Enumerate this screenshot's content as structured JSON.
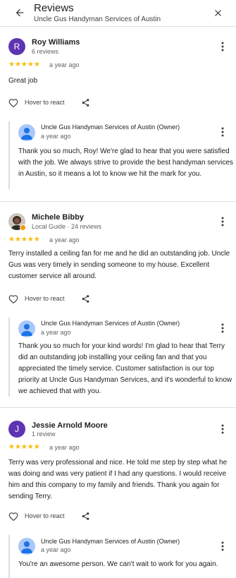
{
  "header": {
    "title": "Reviews",
    "subtitle": "Uncle Gus Handyman Services of Austin",
    "back_icon": "arrow-back-icon",
    "close_icon": "close-icon"
  },
  "colors": {
    "star": "#fbbc04",
    "avatar_roy": "#5e35b1",
    "avatar_jessie": "#5e35b1",
    "owner_avatar": "#a8c7fa",
    "guide_badge": "#f29900"
  },
  "reviews": [
    {
      "avatar_letter": "R",
      "name": "Roy Williams",
      "meta": "6 reviews",
      "rating": 5,
      "stars": "★★★★★",
      "date": "a year ago",
      "text": "Great job",
      "react_label": "Hover to react",
      "owner": {
        "name": "Uncle Gus Handyman Services of Austin (Owner)",
        "date": "a year ago",
        "text": "Thank you so much, Roy! We're glad to hear that you were satisfied with the job. We always strive to provide the best handyman services in Austin, so it means a lot to know we hit the mark for you."
      }
    },
    {
      "name": "Michele Bibby",
      "meta": "Local Guide · 24 reviews",
      "rating": 5,
      "stars": "★★★★★",
      "date": "a year ago",
      "text": "Terry installed a ceiling fan for me and he did an outstanding job. Uncle Gus was very timely in sending someone to my house. Excellent customer service all around.",
      "react_label": "Hover to react",
      "owner": {
        "name": "Uncle Gus Handyman Services of Austin (Owner)",
        "date": "a year ago",
        "text": "Thank you so much for your kind words! I'm glad to hear that Terry did an outstanding job installing your ceiling fan and that you appreciated the timely service. Customer satisfaction is our top priority at Uncle Gus Handyman Services, and it's wonderful to know we achieved that with you."
      }
    },
    {
      "avatar_letter": "J",
      "name": "Jessie Arnold Moore",
      "meta": "1 review",
      "rating": 5,
      "stars": "★★★★★",
      "date": "a year ago",
      "text": "Terry was very professional and nice. He told me step by step what he was doing and was very patient if I had any questions. I would receive him and this company to my family and friends. Thank you again for sending Terry.",
      "react_label": "Hover to react",
      "owner": {
        "name": "Uncle Gus Handyman Services of Austin (Owner)",
        "date": "a year ago",
        "text": "You're an awesome person. We can't wait to work for you again."
      }
    }
  ]
}
